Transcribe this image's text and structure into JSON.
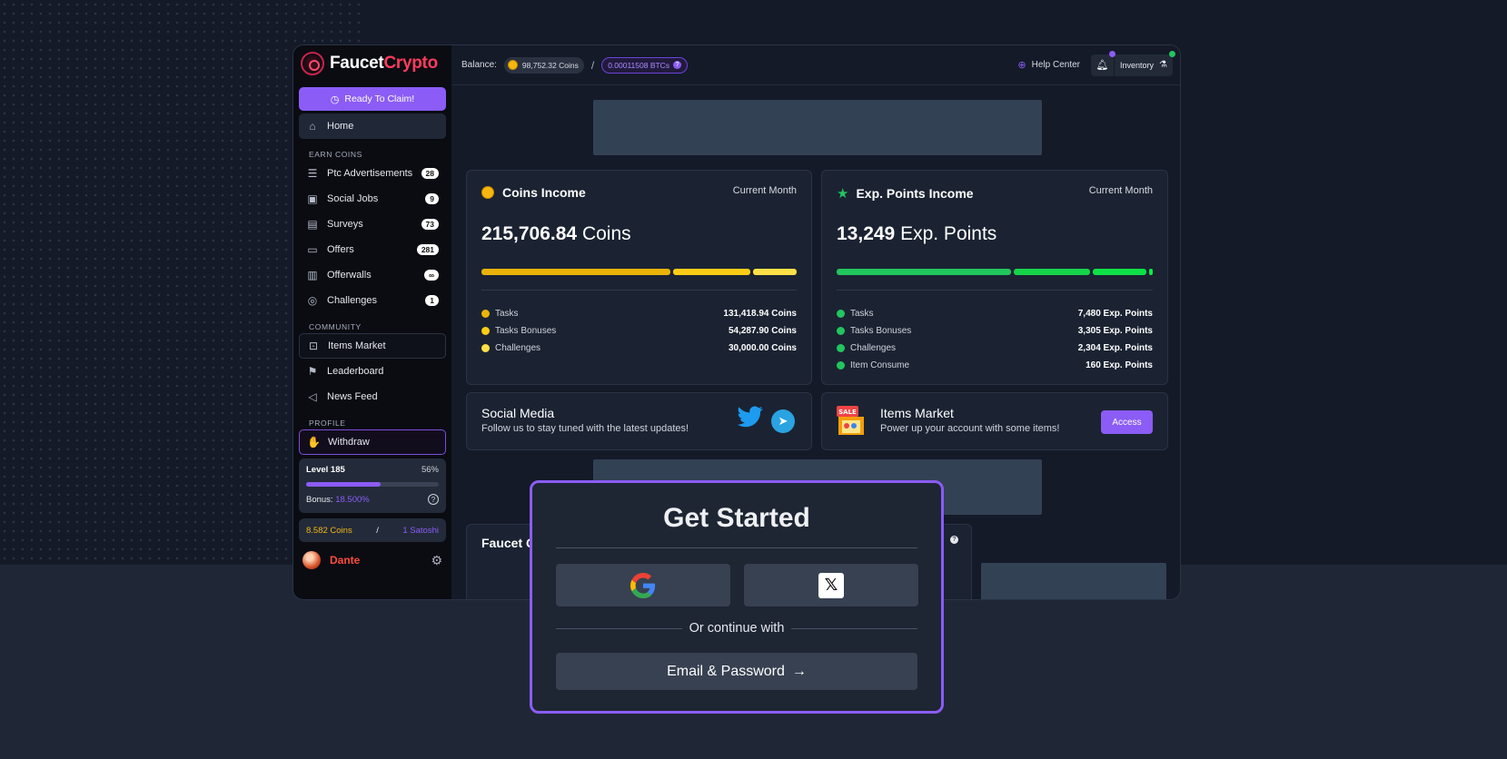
{
  "brand": {
    "name_white": "Faucet",
    "name_red": "Crypto"
  },
  "sidebar": {
    "claim_label": "Ready To Claim!",
    "home_label": "Home",
    "earn_label": "EARN COINS",
    "earn_items": [
      {
        "label": "Ptc Advertisements",
        "badge": "28",
        "icon": "list-icon"
      },
      {
        "label": "Social Jobs",
        "badge": "9",
        "icon": "briefcase-icon"
      },
      {
        "label": "Surveys",
        "badge": "73",
        "icon": "chat-icon"
      },
      {
        "label": "Offers",
        "badge": "281",
        "icon": "ticket-icon"
      },
      {
        "label": "Offerwalls",
        "badge": "∞",
        "icon": "document-icon"
      },
      {
        "label": "Challenges",
        "badge": "1",
        "icon": "target-icon"
      }
    ],
    "community_label": "COMMUNITY",
    "community_items": [
      {
        "label": "Items Market",
        "icon": "shop-icon"
      },
      {
        "label": "Leaderboard",
        "icon": "flag-icon"
      },
      {
        "label": "News Feed",
        "icon": "megaphone-icon"
      }
    ],
    "profile_label": "PROFILE",
    "withdraw_label": "Withdraw",
    "level": {
      "label": "Level 185",
      "percent_text": "56%",
      "progress": 0.56,
      "bonus_label": "Bonus:",
      "bonus_value": "18.500%"
    },
    "coins": {
      "coins": "8.582 Coins",
      "sep": "/",
      "satoshi": "1 Satoshi"
    },
    "user_name": "Dante"
  },
  "topbar": {
    "balance_label": "Balance:",
    "coins": "98,752.32 Coins",
    "sep": "/",
    "btc": "0.00011508 BTCs",
    "help": "Help Center",
    "inventory": "Inventory"
  },
  "coins_income": {
    "title": "Coins Income",
    "period": "Current Month",
    "total_num": "215,706.84",
    "total_unit": "Coins",
    "rows": [
      {
        "label": "Tasks",
        "value": "131,418.94 Coins",
        "color": "#eab308"
      },
      {
        "label": "Tasks Bonuses",
        "value": "54,287.90 Coins",
        "color": "#facc15"
      },
      {
        "label": "Challenges",
        "value": "30,000.00 Coins",
        "color": "#fde047"
      }
    ],
    "segments": [
      {
        "share": 0.61,
        "color": "#eab308"
      },
      {
        "share": 0.25,
        "color": "#facc15"
      },
      {
        "share": 0.14,
        "color": "#fde047"
      }
    ]
  },
  "exp_income": {
    "title": "Exp. Points Income",
    "period": "Current Month",
    "total_num": "13,249",
    "total_unit": "Exp. Points",
    "rows": [
      {
        "label": "Tasks",
        "value": "7,480 Exp. Points",
        "color": "#22c55e"
      },
      {
        "label": "Tasks Bonuses",
        "value": "3,305 Exp. Points",
        "color": "#22c55e"
      },
      {
        "label": "Challenges",
        "value": "2,304 Exp. Points",
        "color": "#22c55e"
      },
      {
        "label": "Item Consume",
        "value": "160 Exp. Points",
        "color": "#22c55e"
      }
    ],
    "segments": [
      {
        "share": 0.565,
        "color": "#22c55e"
      },
      {
        "share": 0.249,
        "color": "#16d34a"
      },
      {
        "share": 0.174,
        "color": "#10e048"
      },
      {
        "share": 0.012,
        "color": "#0aef46"
      }
    ]
  },
  "social": {
    "title": "Social Media",
    "subtitle": "Follow us to stay tuned with the latest updates!"
  },
  "market": {
    "title": "Items Market",
    "subtitle": "Power up your account with some items!",
    "button": "Access",
    "sale": "SALE"
  },
  "faucet": {
    "title": "Faucet C"
  },
  "modal": {
    "title": "Get Started",
    "or_label": "Or continue with",
    "email_label": "Email & Password"
  }
}
